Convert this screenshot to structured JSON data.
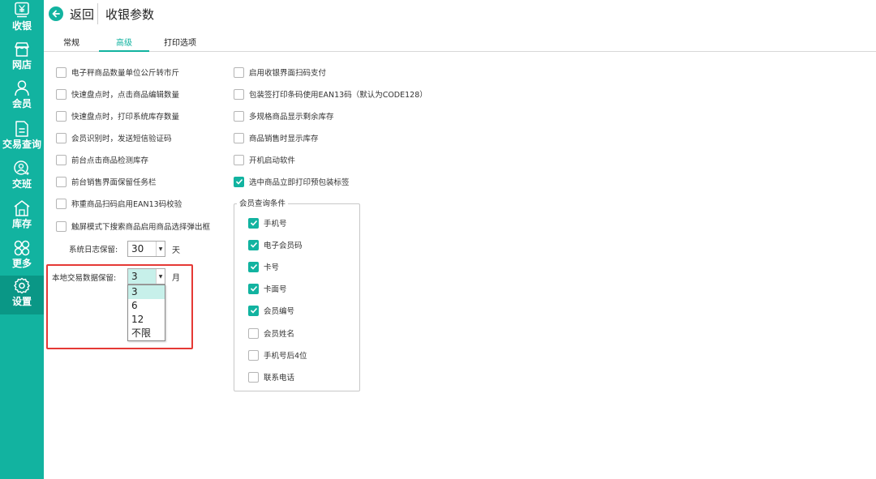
{
  "sidebar": {
    "items": [
      {
        "label": "收银",
        "icon": "cashier-icon"
      },
      {
        "label": "网店",
        "icon": "store-icon"
      },
      {
        "label": "会员",
        "icon": "member-icon"
      },
      {
        "label": "交易查询",
        "icon": "document-icon"
      },
      {
        "label": "交班",
        "icon": "shift-icon"
      },
      {
        "label": "库存",
        "icon": "warehouse-icon"
      },
      {
        "label": "更多",
        "icon": "more-icon"
      },
      {
        "label": "设置",
        "icon": "gear-icon"
      }
    ],
    "active": "设置"
  },
  "header": {
    "back_label": "返回",
    "title": "收银参数"
  },
  "tabs": [
    {
      "label": "常规"
    },
    {
      "label": "高级"
    },
    {
      "label": "打印选项"
    }
  ],
  "active_tab": "高级",
  "left_options": [
    {
      "label": "电子秤商品数量单位公斤转市斤",
      "checked": false
    },
    {
      "label": "快速盘点时，点击商品编辑数量",
      "checked": false
    },
    {
      "label": "快速盘点时，打印系统库存数量",
      "checked": false
    },
    {
      "label": "会员识别时，发送短信验证码",
      "checked": false
    },
    {
      "label": "前台点击商品检测库存",
      "checked": false
    },
    {
      "label": "前台销售界面保留任务栏",
      "checked": false
    },
    {
      "label": "称重商品扫码启用EAN13码校验",
      "checked": false
    },
    {
      "label": "触屏模式下搜索商品启用商品选择弹出框",
      "checked": false
    }
  ],
  "right_options": [
    {
      "label": "启用收银界面扫码支付",
      "checked": false
    },
    {
      "label": "包装签打印条码使用EAN13码（默认为CODE128）",
      "checked": false
    },
    {
      "label": "多规格商品显示剩余库存",
      "checked": false
    },
    {
      "label": "商品销售时显示库存",
      "checked": false
    },
    {
      "label": "开机启动软件",
      "checked": false
    },
    {
      "label": "选中商品立即打印预包装标签",
      "checked": true
    }
  ],
  "member_query": {
    "title": "会员查询条件",
    "options": [
      {
        "label": "手机号",
        "checked": true
      },
      {
        "label": "电子会员码",
        "checked": true
      },
      {
        "label": "卡号",
        "checked": true
      },
      {
        "label": "卡面号",
        "checked": true
      },
      {
        "label": "会员编号",
        "checked": true
      },
      {
        "label": "会员姓名",
        "checked": false
      },
      {
        "label": "手机号后4位",
        "checked": false
      },
      {
        "label": "联系电话",
        "checked": false
      }
    ]
  },
  "log_retention": {
    "label": "系统日志保留:",
    "value": "30",
    "unit": "天"
  },
  "local_retention": {
    "label": "本地交易数据保留:",
    "value": "3",
    "unit": "月",
    "options": [
      "3",
      "6",
      "12",
      "不限"
    ],
    "selected": "3"
  },
  "colors": {
    "accent": "#12b3a0",
    "highlight": "#e53935"
  }
}
